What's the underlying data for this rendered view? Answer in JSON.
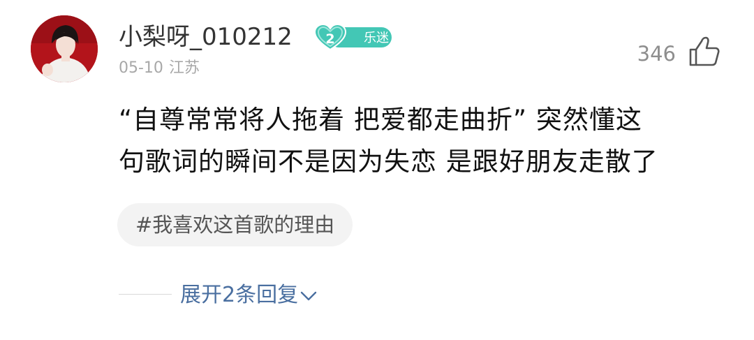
{
  "comment": {
    "user": {
      "name": "小梨呀_010212",
      "badge_level": "2",
      "badge_label": "乐迷"
    },
    "date": "05-10",
    "location": "江苏",
    "likes": "346",
    "text_lines": [
      "“自尊常常将人拖着 把爱都走曲折” 突然懂这",
      "句歌词的瞬间不是因为失恋 是跟好朋友走散了"
    ],
    "topic_tag": "#我喜欢这首歌的理由",
    "expand_replies_label": "展开2条回复",
    "icons": {
      "like": "thumbs-up-icon",
      "expand": "chevron-down-icon",
      "badge": "heart-badge-icon"
    }
  },
  "colors": {
    "badge": "#43c7b5",
    "link": "#4a6fa0",
    "meta": "#a8a8a8"
  }
}
